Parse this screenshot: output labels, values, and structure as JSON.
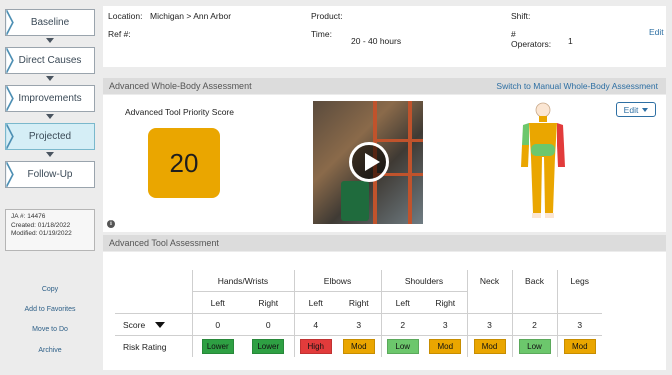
{
  "steps": [
    "Baseline",
    "Direct Causes",
    "Improvements",
    "Projected",
    "Follow-Up"
  ],
  "meta": {
    "ja": "JA #: 14476",
    "created": "Created: 01/18/2022",
    "modified": "Modified: 01/19/2022"
  },
  "side_links": [
    "Copy",
    "Add to Favorites",
    "Move to Do",
    "Archive"
  ],
  "info": {
    "location_label": "Location:",
    "location_value": "Michigan > Ann Arbor",
    "product_label": "Product:",
    "shift_label": "Shift:",
    "ref_label": "Ref #:",
    "time_label": "Time:",
    "time_value": "20 - 40 hours",
    "operators_label_1": "#",
    "operators_label_2": "Operators:",
    "operators_value": "1",
    "edit": "Edit"
  },
  "whole_body": {
    "title": "Advanced Whole-Body Assessment",
    "switch_link": "Switch to Manual Whole-Body Assessment",
    "score_label": "Advanced Tool Priority Score",
    "score": "20",
    "edit_button": "Edit",
    "info_icon": "i"
  },
  "tool_assessment": {
    "title": "Advanced Tool Assessment",
    "groups": [
      "Hands/Wrists",
      "Elbows",
      "Shoulders",
      "Neck",
      "Back",
      "Legs"
    ],
    "sides": [
      "Left",
      "Right",
      "Left",
      "Right",
      "Left",
      "Right"
    ],
    "score_label": "Score",
    "risk_label": "Risk Rating",
    "scores": [
      "0",
      "0",
      "4",
      "3",
      "2",
      "3",
      "3",
      "2",
      "3"
    ],
    "ratings": [
      "Lower",
      "Lower",
      "High",
      "Mod",
      "Low",
      "Mod",
      "Mod",
      "Low",
      "Mod"
    ]
  },
  "colors": {
    "Lower": "#2ea043",
    "High": "#e23b3b",
    "Mod": "#eaa600",
    "Low": "#6cc76c",
    "score_box": "#eaa600",
    "body_green": "#6cc76c",
    "body_red": "#e23b3b",
    "body_yellow": "#eaa600"
  }
}
